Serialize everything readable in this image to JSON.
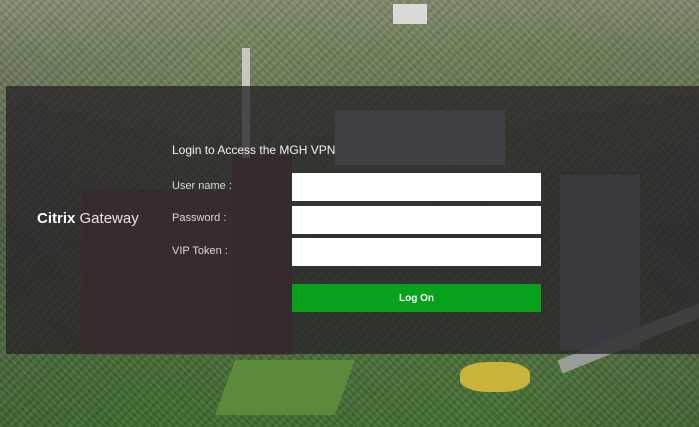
{
  "brand": {
    "name_bold": "Citrix",
    "name_light": "Gateway"
  },
  "form": {
    "title": "Login to Access the MGH VPN",
    "username_label": "User name :",
    "username_value": "",
    "password_label": "Password :",
    "password_value": "",
    "vip_label": "VIP Token :",
    "vip_value": "",
    "logon_label": "Log On"
  },
  "colors": {
    "overlay": "#282428",
    "button": "#07a11b",
    "field": "#ffffff"
  }
}
